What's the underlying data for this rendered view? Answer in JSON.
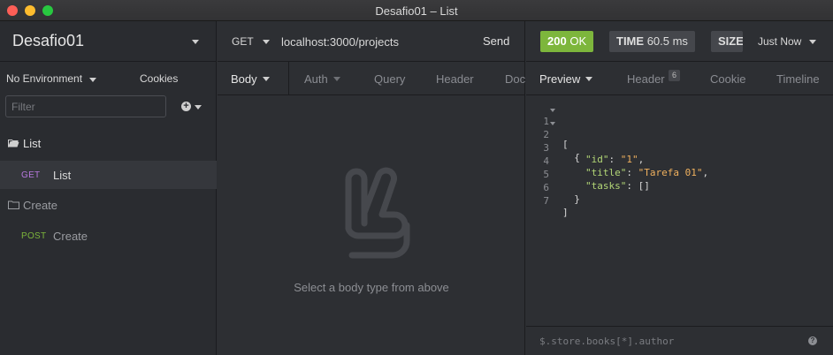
{
  "window": {
    "title": "Desafio01 – List"
  },
  "sidebar": {
    "workspace": "Desafio01",
    "environment": "No Environment",
    "cookies_label": "Cookies",
    "filter_placeholder": "Filter",
    "folders": [
      {
        "name": "List",
        "open": true,
        "requests": [
          {
            "method": "GET",
            "name": "List",
            "active": true
          }
        ]
      },
      {
        "name": "Create",
        "open": false,
        "requests": [
          {
            "method": "POST",
            "name": "Create",
            "active": false
          }
        ]
      }
    ]
  },
  "request": {
    "method": "GET",
    "url": "localhost:3000/projects",
    "send_label": "Send",
    "tabs": [
      "Body",
      "Auth",
      "Query",
      "Header",
      "Docs"
    ],
    "active_tab": "Body",
    "empty_message": "Select a body type from above"
  },
  "response": {
    "status_code": "200",
    "status_text": "OK",
    "time_label": "TIME",
    "time_value": "60.5 ms",
    "size_label": "SIZE",
    "history_label": "Just Now",
    "tabs": [
      "Preview",
      "Header",
      "Cookie",
      "Timeline"
    ],
    "active_tab": "Preview",
    "header_count": "6",
    "body_lines": [
      {
        "n": "1",
        "text": "["
      },
      {
        "n": "2",
        "text": "  {"
      },
      {
        "n": "3",
        "key": "\"id\"",
        "value": "\"1\"",
        "trail": ","
      },
      {
        "n": "4",
        "key": "\"title\"",
        "value": "\"Tarefa 01\"",
        "trail": ","
      },
      {
        "n": "5",
        "key": "\"tasks\"",
        "value": "[]",
        "trail": ""
      },
      {
        "n": "6",
        "text": "  }"
      },
      {
        "n": "7",
        "text": "]"
      }
    ],
    "filter_placeholder": "$.store.books[*].author",
    "help_icon_glyph": "?"
  },
  "colors": {
    "status_ok": "#7db63c",
    "method_get": "#b678dd",
    "method_post": "#7db63c",
    "json_key": "#b3d776",
    "json_string": "#f0b15e"
  }
}
